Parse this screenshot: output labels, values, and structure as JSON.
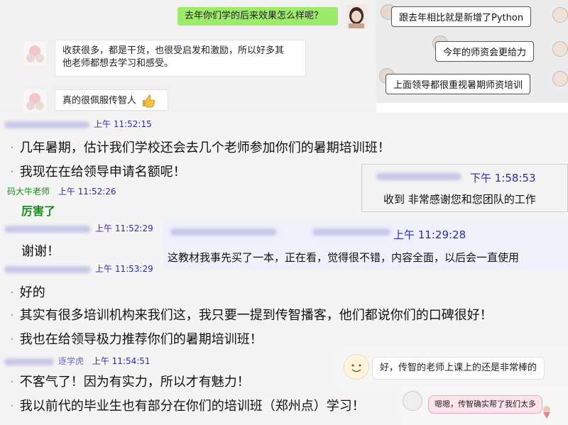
{
  "top_chat": {
    "msg_right": "去年你们学的后来效果怎么样呢？",
    "msg_left_1": "收获很多，都是干货，也很受启发和激励，所以好多其他老师都想去学习和感受。",
    "msg_left_1_line1": "收获很多，都是干货，也很受启发和激励，所以好多其",
    "msg_left_1_line2": "他老师都想去学习和感受。",
    "msg_left_2": "真的很佩服传智人"
  },
  "right_chat": {
    "msg_1": "跟去年相比就是新增了Python",
    "msg_2": "今年的师资会更给力",
    "msg_3": "上面领导都很重视暑期师资培训"
  },
  "qq_chat": {
    "time_1": "上午 11:52:15",
    "line_1": "几年暑期，估计我们学校还会去几个老师参加你们的暑期培训班！",
    "line_2": "我现在在给领导申请名额呢！",
    "sender_2": "码大牛老师",
    "time_2": "上午 11:52:26",
    "line_3": "厉害了",
    "time_3": "上午 11:52:29",
    "line_4": "谢谢！",
    "time_4": "上午 11:53:29",
    "line_5": "好的",
    "line_6": "其实有很多培训机构来我们这，我只要一提到传智播客，他们都说你们的口碑很好！",
    "line_7": "我也在给领导极力推荐你们的暑期培训班！",
    "sender_5_partial": "逐学虎",
    "time_5": "上午 11:54:51",
    "line_8": "不客气了！因为有实力，所以才有魅力！",
    "line_9": "我以前代的毕业生也有部分在你们的培训班（郑州点）学习！"
  },
  "popup_1": {
    "time": "下午 1:58:53",
    "text": "收到 非常感谢您和您团队的工作"
  },
  "popup_2": {
    "time": "上午 11:29:28",
    "text": "这教材我事先买了一本，正在看，觉得很不错，内容全面，以后会一直使用"
  },
  "popup_3": {
    "text": "好，传智的老师上课上的还是非常棒的"
  },
  "popup_4": {
    "text": "嗯嗯，传智确实帮了我们太多"
  },
  "colors": {
    "wechat_green": "#9eea6a",
    "qq_time_blue": "#2a2ab0",
    "sender_green": "#1a8c1a",
    "pink_bubble": "#fde3ea"
  }
}
